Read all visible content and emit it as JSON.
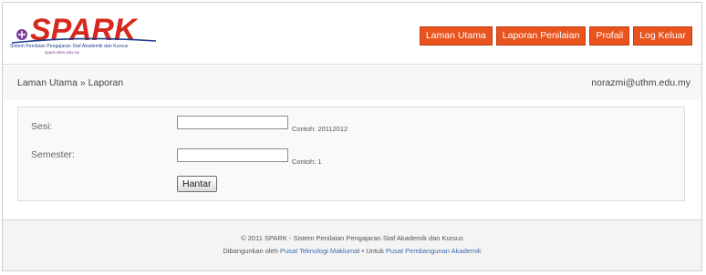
{
  "logo": {
    "text": "SPARK",
    "subtitle": "Sistem Penilaian Pengajaran Staf Akademik dan Kursus",
    "url": "spark.uthm.edu.my",
    "colors": {
      "wordmark": "#d6281e",
      "underline": "#1a3a8a",
      "crest": "#7a3e9a"
    }
  },
  "nav": {
    "items": [
      "Laman Utama",
      "Laporan Penilaian",
      "Profail",
      "Log Keluar"
    ],
    "color": "#e8531e"
  },
  "breadcrumb": {
    "home": "Laman Utama",
    "separator": "»",
    "current": "Laporan"
  },
  "user": {
    "email": "norazmi@uthm.edu.my"
  },
  "form": {
    "sesi": {
      "label": "Sesi:",
      "value": "",
      "hint": "Contoh: 20112012"
    },
    "semester": {
      "label": "Semester:",
      "value": "",
      "hint": "Contoh: 1"
    },
    "submit_label": "Hantar"
  },
  "footer": {
    "line1": "© 2011 SPARK - Sistem Penilaian Pengajaran Staf Akademik dan Kursus",
    "built_by": "Dibangunkan oleh",
    "org1": "Pusat Teknologi Maklumat",
    "bullet": "•",
    "for": "Untuk",
    "org2": "Pusat Pembangunan Akademik"
  }
}
